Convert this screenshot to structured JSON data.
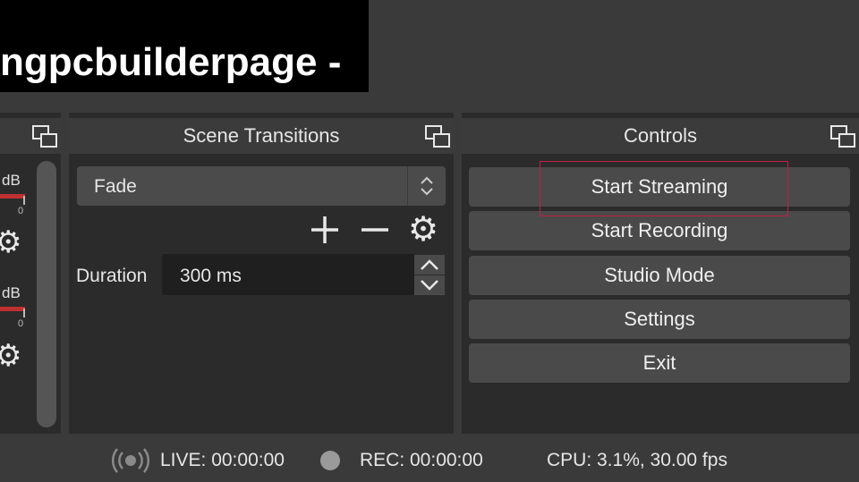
{
  "window": {
    "title_fragment": "ngpcbuilderpage -"
  },
  "mixer": {
    "channels": [
      {
        "db_label": "dB",
        "zero_label": "0"
      },
      {
        "db_label": "dB",
        "zero_label": "0"
      }
    ]
  },
  "transitions": {
    "header": "Scene Transitions",
    "selected": "Fade",
    "duration_label": "Duration",
    "duration_value": "300 ms"
  },
  "controls": {
    "header": "Controls",
    "buttons": [
      "Start Streaming",
      "Start Recording",
      "Studio Mode",
      "Settings",
      "Exit"
    ]
  },
  "status": {
    "live": "LIVE: 00:00:00",
    "rec": "REC: 00:00:00",
    "perf": "CPU: 3.1%, 30.00 fps"
  },
  "colors": {
    "highlight": "#c0213b",
    "meter": "#c03030",
    "panel": "#2b2b2b",
    "button": "#4a4a4a"
  }
}
